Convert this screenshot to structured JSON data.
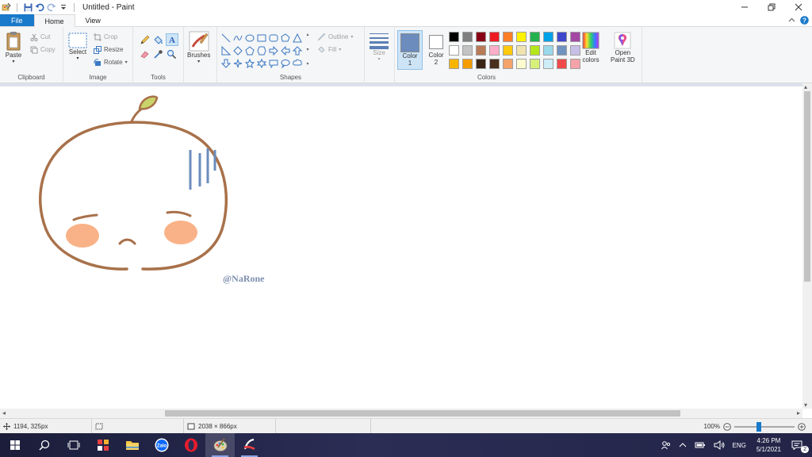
{
  "window": {
    "title": "Untitled - Paint",
    "minimize_label": "—",
    "restore_label": "❐",
    "close_label": "✕"
  },
  "tabs": {
    "file": "File",
    "home": "Home",
    "view": "View"
  },
  "ribbon": {
    "clipboard": {
      "group": "Clipboard",
      "paste": "Paste",
      "cut": "Cut",
      "copy": "Copy"
    },
    "image": {
      "group": "Image",
      "select": "Select",
      "crop": "Crop",
      "resize": "Resize",
      "rotate": "Rotate"
    },
    "tools": {
      "group": "Tools"
    },
    "brushes": {
      "label": "Brushes"
    },
    "shapes": {
      "group": "Shapes",
      "outline": "Outline",
      "fill": "Fill"
    },
    "size": {
      "label": "Size"
    },
    "colors": {
      "group": "Colors",
      "color1_label": "Color",
      "color1_num": "1",
      "color2_label": "Color",
      "color2_num": "2",
      "color1_value": "#6b8cbd",
      "color2_value": "#ffffff",
      "edit_label": "Edit",
      "edit_label2": "colors",
      "paint3d_label": "Open",
      "paint3d_label2": "Paint 3D",
      "palette": [
        "#000000",
        "#7f7f7f",
        "#880015",
        "#ed1c24",
        "#ff7f27",
        "#fff200",
        "#22b14c",
        "#00a2e8",
        "#3f48cc",
        "#a349a4",
        "#ffffff",
        "#c3c3c3",
        "#b97a57",
        "#ffaec9",
        "#ffc90e",
        "#efe4b0",
        "#b5e61d",
        "#99d9ea",
        "#7092be",
        "#c8bfe7",
        "#f7b500",
        "#f59c00",
        "#3a2413",
        "#4a2f1e",
        "#f4a46a",
        "#fffbd0",
        "#d6f07a",
        "#cdeef7",
        "#ef4b4b",
        "#f5a3a8"
      ]
    }
  },
  "drawing": {
    "stroke_color": "#a8714a",
    "blush_color": "#f9b287",
    "leaf_color": "#c9d46a",
    "lines_color": "#6b8cbd",
    "signature": "@NaRone"
  },
  "status": {
    "cursor_pos": "1194, 325px",
    "canvas_size": "2038 × 866px",
    "zoom": "100%"
  },
  "taskbar": {
    "time": "4:26 PM",
    "date": "5/1/2021",
    "lang": "ENG",
    "notif_count": "2"
  }
}
